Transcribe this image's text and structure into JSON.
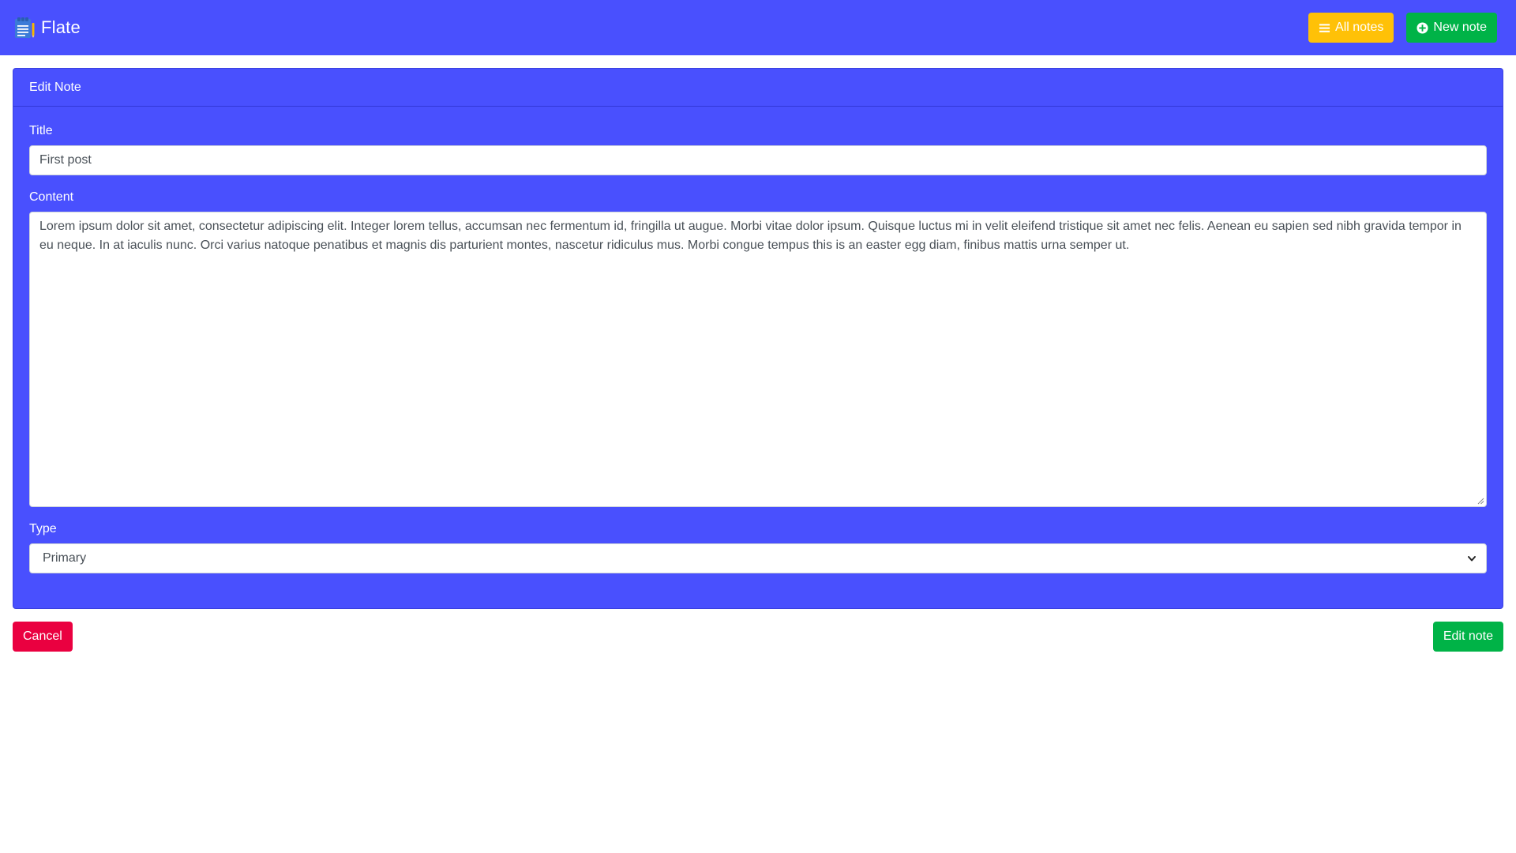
{
  "navbar": {
    "brand": {
      "name": "Flate",
      "logo_icon": "notepad-icon"
    },
    "buttons": {
      "all_notes": {
        "label": "All notes",
        "icon": "list-icon",
        "color": "#ffc107"
      },
      "new_note": {
        "label": "New note",
        "icon": "plus-circle-icon",
        "color": "#00b347"
      }
    },
    "background": "#4950fe"
  },
  "form": {
    "header": "Edit Note",
    "title": {
      "label": "Title",
      "value": "First post"
    },
    "content": {
      "label": "Content",
      "value": "Lorem ipsum dolor sit amet, consectetur adipiscing elit. Integer lorem tellus, accumsan nec fermentum id, fringilla ut augue. Morbi vitae dolor ipsum. Quisque luctus mi in velit eleifend tristique sit amet nec felis. Aenean eu sapien sed nibh gravida tempor in eu neque. In at iaculis nunc. Orci varius natoque penatibus et magnis dis parturient montes, nascetur ridiculus mus. Morbi congue tempus this is an easter egg diam, finibus mattis urna semper ut."
    },
    "type": {
      "label": "Type",
      "selected": "Primary"
    }
  },
  "actions": {
    "cancel": {
      "label": "Cancel",
      "color": "#ea0040"
    },
    "submit": {
      "label": "Edit note",
      "color": "#00b347"
    }
  }
}
